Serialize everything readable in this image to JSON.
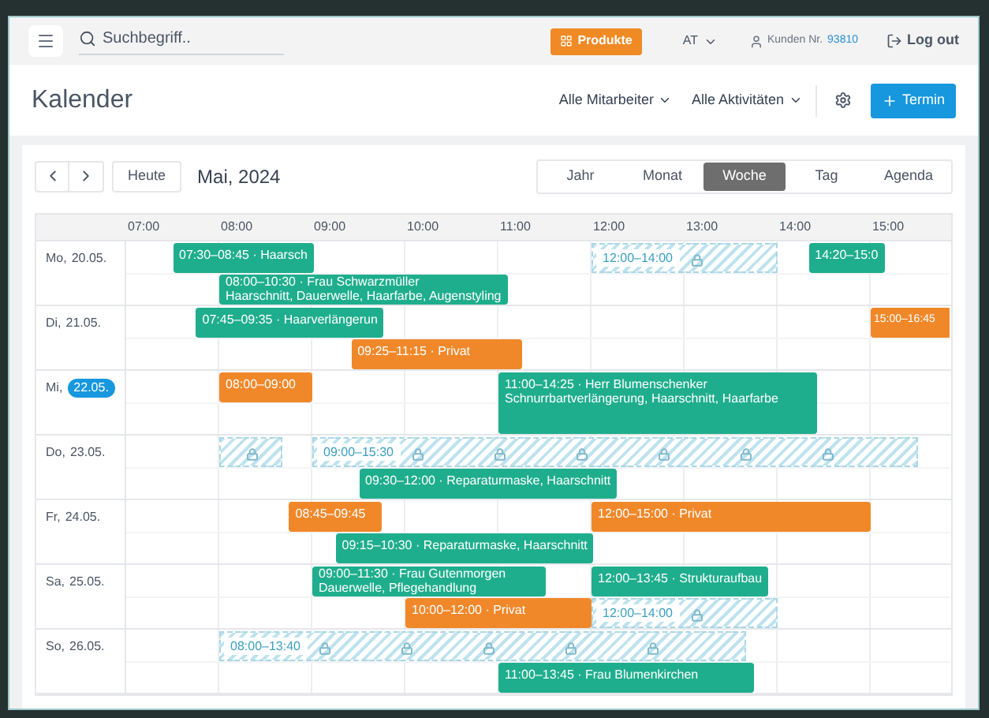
{
  "topbar": {
    "search": {
      "placeholder": "Suchbegriff.."
    },
    "products_button": "Produkte",
    "language": "AT",
    "customer_label": "Kunden Nr.",
    "customer_number": "93810",
    "logout": "Log out"
  },
  "header": {
    "title": "Kalender",
    "filters": [
      "Alle Mitarbeiter",
      "Alle Aktivitäten"
    ],
    "new_button": "Termin"
  },
  "toolbar": {
    "today": "Heute",
    "period": "Mai, 2024",
    "views": [
      {
        "label": "Jahr",
        "selected": false
      },
      {
        "label": "Monat",
        "selected": false
      },
      {
        "label": "Woche",
        "selected": true
      },
      {
        "label": "Tag",
        "selected": false
      },
      {
        "label": "Agenda",
        "selected": false
      }
    ]
  },
  "hours": [
    "07:00",
    "08:00",
    "09:00",
    "10:00",
    "11:00",
    "12:00",
    "13:00",
    "14:00",
    "15:00"
  ],
  "days": [
    {
      "weekday": "Mo,",
      "date": "20.05.",
      "today": false,
      "lanes": [
        {
          "events": [
            {
              "kind": "appointment",
              "text": "07:30–08:45 · Haarsch"
            },
            {
              "kind": "blocked",
              "text": "12:00–14:00"
            },
            {
              "kind": "appointment",
              "text": "14:20–15:0"
            }
          ]
        },
        {
          "events": [
            {
              "kind": "appointment",
              "text": "08:00–10:30 · Frau Schwarzmüller",
              "detail": "Haarschnitt, Dauerwelle, Haarfarbe, Augenstyling"
            }
          ]
        }
      ]
    },
    {
      "weekday": "Di,",
      "date": "21.05.",
      "today": false,
      "lanes": [
        {
          "events": [
            {
              "kind": "appointment",
              "text": "07:45–09:35 · Haarverlängerun"
            },
            {
              "kind": "private",
              "text": "15:00–16:45"
            }
          ]
        },
        {
          "events": [
            {
              "kind": "private",
              "text": "09:25–11:15 · Privat"
            }
          ]
        }
      ]
    },
    {
      "weekday": "Mi,",
      "date": "22.05.",
      "today": true,
      "lanes": [
        {
          "events": [
            {
              "kind": "private",
              "text": "08:00–09:00"
            }
          ]
        }
      ],
      "spanning_events": [
        {
          "kind": "appointment",
          "text": "11:00–14:25 · Herr Blumenschenker",
          "detail": "Schnurrbartverlängerung, Haarschnitt, Haarfarbe"
        }
      ]
    },
    {
      "weekday": "Do,",
      "date": "23.05.",
      "today": false,
      "lanes": [
        {
          "events": [
            {
              "kind": "blocked",
              "text": "09:00–15:30"
            }
          ]
        },
        {
          "events": [
            {
              "kind": "appointment",
              "text": "09:30–12:00 · Reparaturmaske, Haarschnitt"
            }
          ]
        }
      ]
    },
    {
      "weekday": "Fr,",
      "date": "24.05.",
      "today": false,
      "lanes": [
        {
          "events": [
            {
              "kind": "private",
              "text": "08:45–09:45"
            },
            {
              "kind": "private",
              "text": "12:00–15:00 · Privat"
            }
          ]
        },
        {
          "events": [
            {
              "kind": "appointment",
              "text": "09:15–10:30 · Reparaturmaske, Haarschnitt"
            }
          ]
        }
      ]
    },
    {
      "weekday": "Sa,",
      "date": "25.05.",
      "today": false,
      "lanes": [
        {
          "events": [
            {
              "kind": "appointment",
              "text": "09:00–11:30 · Frau Gutenmorgen",
              "detail": "Dauerwelle, Pflegehandlung"
            },
            {
              "kind": "appointment",
              "text": "12:00–13:45 · Strukturaufbau"
            }
          ]
        },
        {
          "events": [
            {
              "kind": "private",
              "text": "10:00–12:00 · Privat"
            },
            {
              "kind": "blocked",
              "text": "12:00–14:00"
            }
          ]
        }
      ]
    },
    {
      "weekday": "So,",
      "date": "26.05.",
      "today": false,
      "lanes": [
        {
          "events": [
            {
              "kind": "blocked",
              "text": "08:00–13:40"
            }
          ]
        },
        {
          "events": [
            {
              "kind": "appointment",
              "text": "11:00–13:45 · Frau Blumenkirchen"
            }
          ]
        }
      ]
    }
  ]
}
